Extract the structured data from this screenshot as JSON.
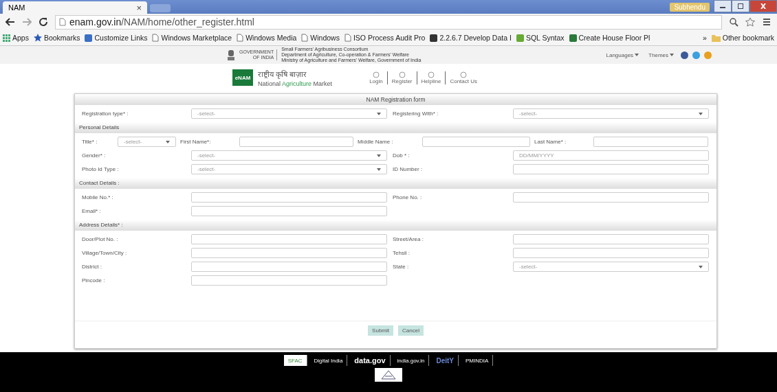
{
  "browser": {
    "tab": {
      "title": "NAM",
      "close": "×"
    },
    "profile": "Subhendu",
    "url": {
      "host": "enam.gov.in",
      "path": "/NAM/home/other_register.html"
    },
    "bookmarks": [
      {
        "label": "Apps",
        "kind": "apps"
      },
      {
        "label": "Bookmarks",
        "kind": "star"
      },
      {
        "label": "Customize Links",
        "kind": "m"
      },
      {
        "label": "Windows Marketplace",
        "kind": "page"
      },
      {
        "label": "Windows Media",
        "kind": "page"
      },
      {
        "label": "Windows",
        "kind": "page"
      },
      {
        "label": "ISO Process Audit Pro",
        "kind": "page"
      },
      {
        "label": "2.2.6.7 Develop Data I",
        "kind": "s"
      },
      {
        "label": "SQL Syntax",
        "kind": "sql"
      },
      {
        "label": "Create House Floor Pl",
        "kind": "h"
      }
    ],
    "more": "»",
    "other": "Other bookmark"
  },
  "gov_strip": {
    "government": [
      "GOVERNMENT",
      "OF INDIA"
    ],
    "lines": [
      "Small Farmers' Agribusiness Consortium",
      "Department of Agriculture, Co-operation & Farmers' Welfare",
      "Ministry of Agriculture and Farmers' Welfare, Government of India"
    ],
    "languages": "Languages",
    "themes": "Themes"
  },
  "header": {
    "logo": "eNAM",
    "hindi": "राष्ट्रीय कृषि बाज़ार",
    "name_parts": [
      "National",
      "Agriculture",
      "Market"
    ],
    "nav": [
      {
        "label": "Login"
      },
      {
        "label": "Register"
      },
      {
        "label": "Helpline"
      },
      {
        "label": "Contact Us"
      }
    ]
  },
  "form": {
    "title": "NAM Registration form",
    "sections": [
      {
        "fields": [
          {
            "label": "Registration type* :",
            "kind": "select",
            "value": "-select-"
          },
          {
            "label": "Registering With* :",
            "kind": "select",
            "value": "-select-"
          }
        ]
      },
      {
        "heading": "Personal Details",
        "name_row": [
          {
            "label": "Title* :",
            "kind": "select",
            "value": "-select-"
          },
          {
            "label": "First Name*:",
            "kind": "text"
          },
          {
            "label": "Middle Name :",
            "kind": "text"
          },
          {
            "label": "Last Name* :",
            "kind": "text"
          }
        ],
        "fields": [
          {
            "label": "Gender* :",
            "kind": "select",
            "value": "-select-"
          },
          {
            "label": "Dob * :",
            "kind": "text",
            "placeholder": "DD/MM/YYYY"
          },
          {
            "label": "Photo Id Type :",
            "kind": "select",
            "value": "-select-"
          },
          {
            "label": "ID Number :",
            "kind": "text"
          }
        ]
      },
      {
        "heading": "Contact Details :",
        "fields": [
          {
            "label": "Mobile No.* :",
            "kind": "text"
          },
          {
            "label": "Phone No. :",
            "kind": "text"
          },
          {
            "label": "Email* :",
            "kind": "text"
          }
        ]
      },
      {
        "heading": "Address Details* :",
        "fields": [
          {
            "label": "Door/Plot No. :",
            "kind": "text"
          },
          {
            "label": "Street/Area :",
            "kind": "text"
          },
          {
            "label": "Village/Town/City :",
            "kind": "text"
          },
          {
            "label": "Tehsil :",
            "kind": "text"
          },
          {
            "label": "District :",
            "kind": "text"
          },
          {
            "label": "State :",
            "kind": "select",
            "value": "-select-"
          },
          {
            "label": "Pincode :",
            "kind": "text"
          }
        ]
      }
    ],
    "buttons": [
      "Submit",
      "Cancel"
    ]
  },
  "footer": {
    "logos": [
      "SFAC",
      "Digital India",
      "data.gov",
      "india.gov.in",
      "DeitY",
      "PMINDIA"
    ]
  }
}
